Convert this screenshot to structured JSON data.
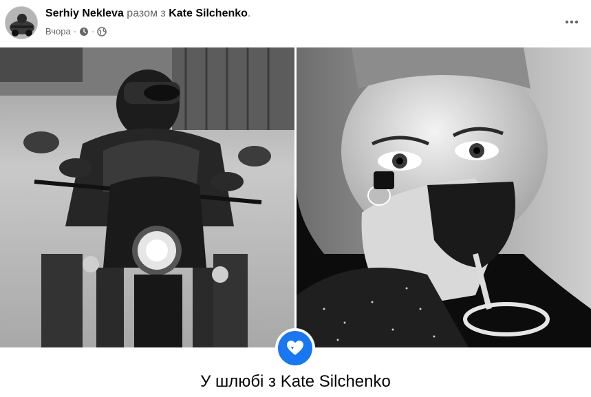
{
  "post": {
    "author": "Serhiy Nekleva",
    "with_text": " разом з ",
    "tagged": "Kate Silchenko",
    "end_punct": ".",
    "time": "Вчора",
    "separator": "·",
    "privacy_icon": "globe-icon",
    "clock_icon": "clock-icon",
    "more_icon": "more-horizontal-icon"
  },
  "life_event": {
    "icon": "heart-icon",
    "text": "У шлюбі з Kate Silchenko"
  },
  "colors": {
    "brand_blue": "#1877f2",
    "secondary_text": "#65676b",
    "primary_text": "#050505"
  }
}
